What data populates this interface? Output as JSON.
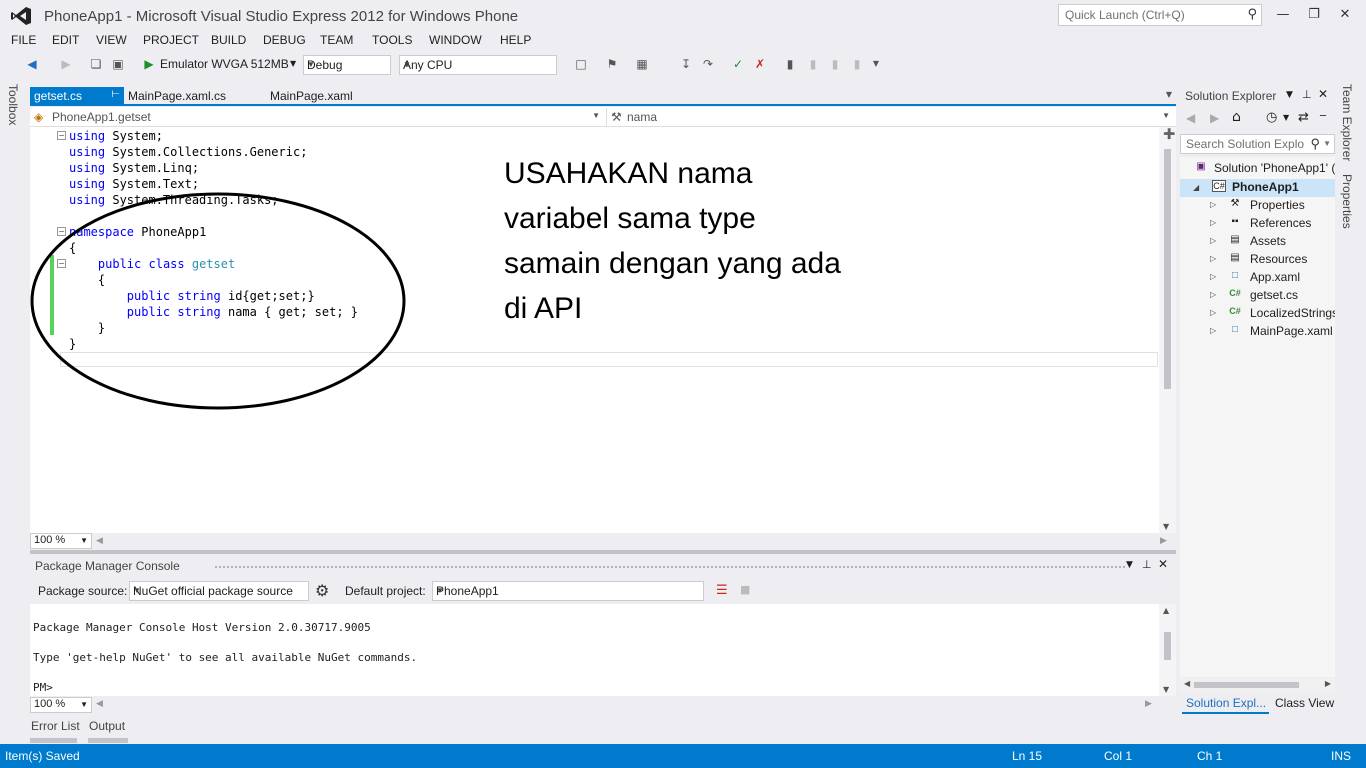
{
  "window": {
    "title": "PhoneApp1 - Microsoft Visual Studio Express 2012 for Windows Phone",
    "quick_launch_placeholder": "Quick Launch (Ctrl+Q)"
  },
  "menu": [
    "FILE",
    "EDIT",
    "VIEW",
    "PROJECT",
    "BUILD",
    "DEBUG",
    "TEAM",
    "TOOLS",
    "WINDOW",
    "HELP"
  ],
  "toolbar": {
    "run_target": "Emulator WVGA 512MB",
    "configuration": "Debug",
    "platform": "Any CPU"
  },
  "left_strip": {
    "toolbox_label": "Toolbox"
  },
  "tabs": [
    {
      "label": "getset.cs",
      "active": true
    },
    {
      "label": "MainPage.xaml.cs",
      "active": false
    },
    {
      "label": "MainPage.xaml",
      "active": false
    }
  ],
  "navbar": {
    "type_combo": "PhoneApp1.getset",
    "member_combo": "nama"
  },
  "code": {
    "usings": [
      "System;",
      "System.Collections.Generic;",
      "System.Linq;",
      "System.Text;",
      "System.Threading.Tasks;"
    ],
    "namespace_name": "PhoneApp1",
    "class_name": "getset",
    "prop1": "id{get;set;}",
    "prop2": "nama { get; set; }"
  },
  "annotation": {
    "lines": [
      "USAHAKAN nama",
      "variabel sama type",
      "samain dengan yang ada",
      "di API"
    ]
  },
  "editor_zoom": "100 %",
  "package_manager_console": {
    "title": "Package Manager Console",
    "package_source_label": "Package source:",
    "package_source_value": "NuGet official package source",
    "default_project_label": "Default project:",
    "default_project_value": "PhoneApp1",
    "output_lines": [
      "Package Manager Console Host Version 2.0.30717.9005",
      "Type 'get-help NuGet' to see all available NuGet commands.",
      "PM>"
    ],
    "zoom": "100 %"
  },
  "bottom_tabs": [
    "Error List",
    "Output"
  ],
  "status_bar": {
    "message": "Item(s) Saved",
    "ln": "Ln 15",
    "col": "Col 1",
    "ch": "Ch 1",
    "mode": "INS"
  },
  "solution_explorer": {
    "title": "Solution Explorer",
    "search_placeholder": "Search Solution Explo",
    "solution": "Solution 'PhoneApp1' (",
    "project": "PhoneApp1",
    "items": [
      "Properties",
      "References",
      "Assets",
      "Resources",
      "App.xaml",
      "getset.cs",
      "LocalizedStrings",
      "MainPage.xaml"
    ],
    "bottom_tabs": [
      "Solution Expl...",
      "Class View"
    ]
  },
  "right_strip": {
    "team_explorer": "Team Explorer",
    "properties": "Properties"
  }
}
